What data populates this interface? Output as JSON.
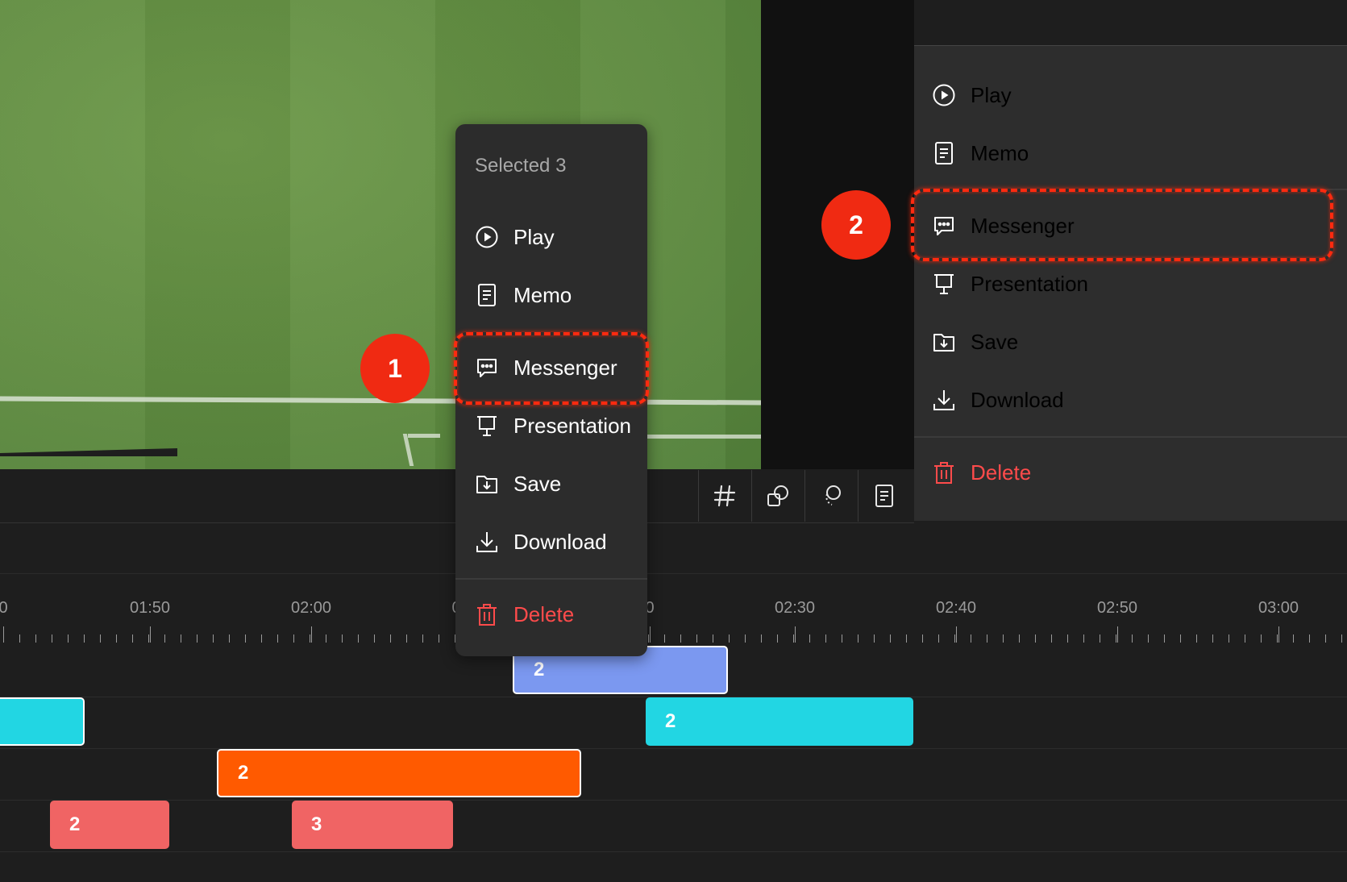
{
  "colors": {
    "accent_annotation": "#f02a12",
    "delete": "#ff4b4b",
    "clip_blue": "#7b98f0",
    "clip_cyan": "#22d6e3",
    "clip_orange": "#ff5a00",
    "clip_red": "#f06464"
  },
  "video": {
    "description_icon": "video-frame"
  },
  "toolbar": {
    "buttons": [
      {
        "icon": "hash-icon"
      },
      {
        "icon": "shapes-icon"
      },
      {
        "icon": "lasso-icon"
      },
      {
        "icon": "memo-icon"
      }
    ]
  },
  "timeline": {
    "tick_labels": [
      "0",
      "01:50",
      "02:00",
      "0",
      "0",
      "02:30",
      "02:40",
      "02:50",
      "03:00"
    ],
    "clips": [
      {
        "label": "2",
        "color": "#7b98f0"
      },
      {
        "label": "",
        "color": "#22d6e3"
      },
      {
        "label": "2",
        "color": "#22d6e3"
      },
      {
        "label": "2",
        "color": "#ff5a00"
      },
      {
        "label": "2",
        "color": "#f06464"
      },
      {
        "label": "3",
        "color": "#f06464"
      }
    ]
  },
  "context_menu": {
    "header": "Selected 3",
    "items": [
      {
        "label": "Play",
        "icon": "play-icon"
      },
      {
        "label": "Memo",
        "icon": "memo-icon"
      },
      {
        "label": "Messenger",
        "icon": "messenger-icon"
      },
      {
        "label": "Presentation",
        "icon": "presentation-icon"
      },
      {
        "label": "Save",
        "icon": "save-icon"
      },
      {
        "label": "Download",
        "icon": "download-icon"
      },
      {
        "label": "Delete",
        "icon": "trash-icon"
      }
    ]
  },
  "side_menu": {
    "items": [
      {
        "label": "Play",
        "icon": "play-icon"
      },
      {
        "label": "Memo",
        "icon": "memo-icon"
      },
      {
        "label": "Messenger",
        "icon": "messenger-icon"
      },
      {
        "label": "Presentation",
        "icon": "presentation-icon"
      },
      {
        "label": "Save",
        "icon": "save-icon"
      },
      {
        "label": "Download",
        "icon": "download-icon"
      },
      {
        "label": "Delete",
        "icon": "trash-icon"
      }
    ]
  },
  "annotations": {
    "badge_1": "1",
    "badge_2": "2"
  }
}
